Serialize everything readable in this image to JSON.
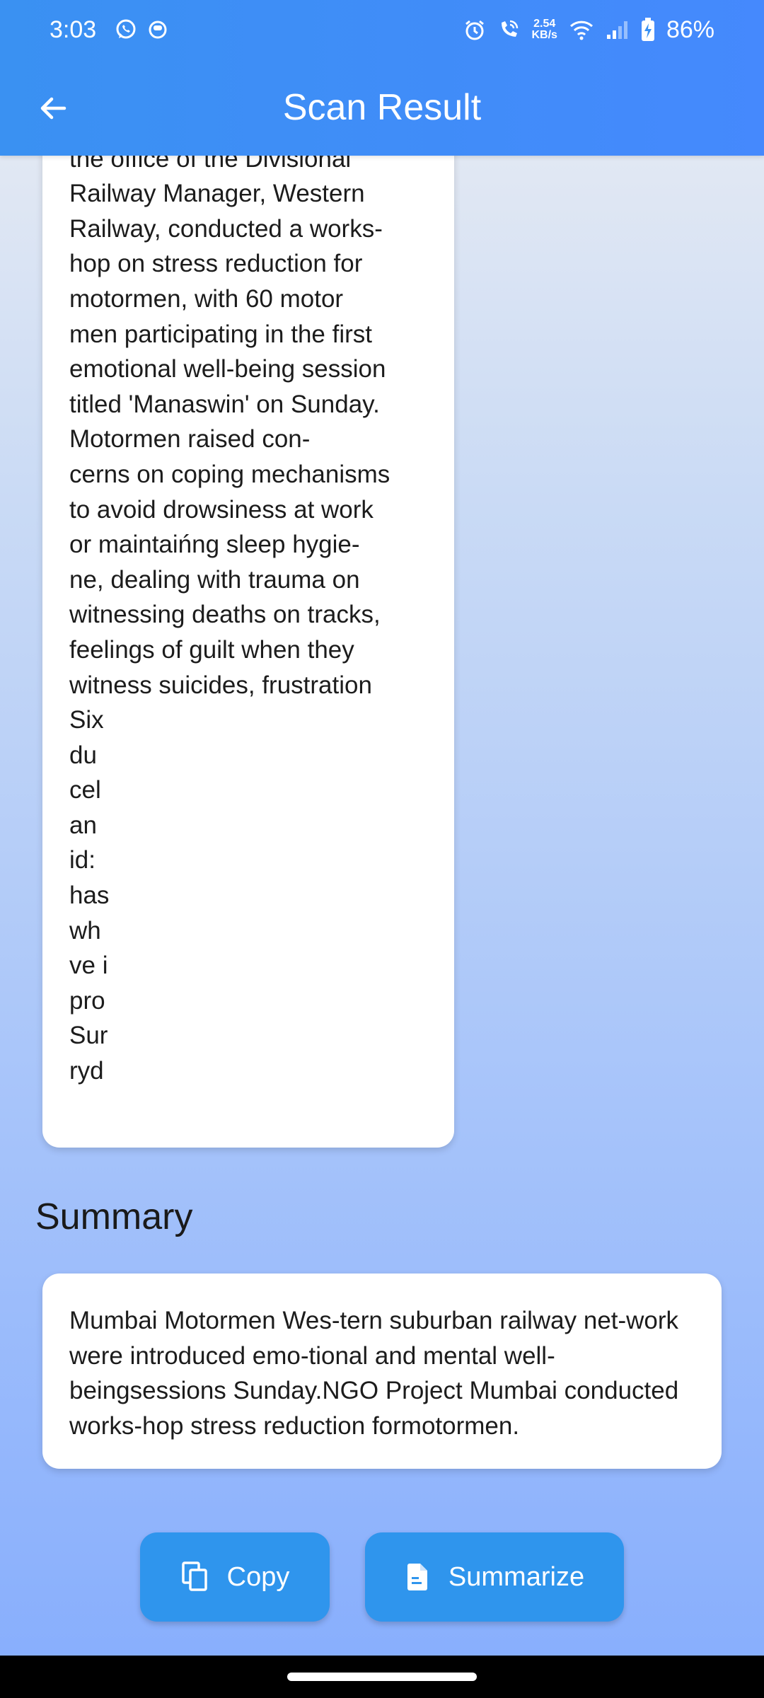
{
  "status_bar": {
    "time": "3:03",
    "net_speed_value": "2.54",
    "net_speed_unit": "KB/s",
    "battery": "86%"
  },
  "app_bar": {
    "title": "Scan Result"
  },
  "ocr": {
    "lines": "NGO Project Mumbai, in\nthe office of the Divisional\nRailway Manager, Western\nRailway, conducted a works-\nhop on stress reduction for\nmotormen, with 60 motor\nmen participating in the first\nemotional well-being session\ntitled 'Manaswin' on Sunday.\nMotormen raised con-\ncerns on coping mechanisms\nto avoid drowsiness at work\nor maintaińng sleep hygie-\nne, dealing with trauma on\nwitnessing deaths on tracks,\nfeelings of guilt when they\nwitness suicides, frustration\nSix\ndu\ncel\nan\nid:\nhas\nwh\nve i\npro\nSur\nryd"
  },
  "summary": {
    "heading": "Summary",
    "text": "Mumbai Motormen Wes-tern suburban railway net-work were introduced emo-tional and mental well-beingsessions Sunday.NGO Project Mumbai conducted works-hop stress reduction formotormen."
  },
  "actions": {
    "copy_label": "Copy",
    "summarize_label": "Summarize"
  },
  "icons": {
    "back": "arrow-left-icon",
    "copy": "copy-icon",
    "summarize": "document-icon"
  }
}
